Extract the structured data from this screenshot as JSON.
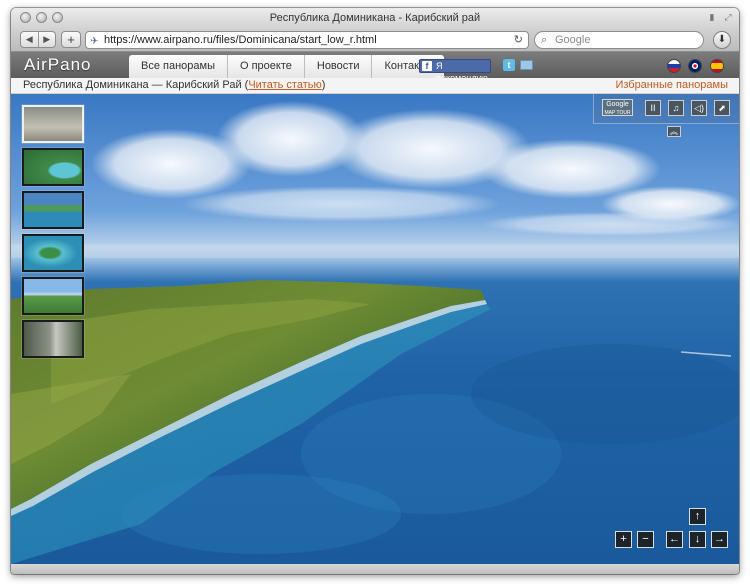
{
  "window": {
    "title": "Республика Доминикана - Карибский рай"
  },
  "toolbar": {
    "back_icon": "back-arrow-icon",
    "forward_icon": "forward-arrow-icon",
    "add_tab_label": "+",
    "url": "https://www.airpano.ru/files/Dominicana/start_low_r.html",
    "search_placeholder": "Google"
  },
  "site": {
    "logo": "AirPano",
    "nav": [
      {
        "label": "Все панорамы"
      },
      {
        "label": "О проекте"
      },
      {
        "label": "Новости"
      },
      {
        "label": "Контакты"
      }
    ],
    "facebook_label": "Я рекомендую",
    "languages": [
      "ru",
      "en",
      "es"
    ]
  },
  "subbar": {
    "title_prefix": "Республика Доминикана — Карибский Рай (",
    "read_link": "Читать статью",
    "title_suffix": ")",
    "favorites": "Избранные панорамы"
  },
  "pano_controls": {
    "google_map_label_1": "Google",
    "google_map_label_2": "MAP TOUR",
    "pause": "II",
    "zoom_in": "+",
    "zoom_out": "−",
    "up": "↑",
    "down": "↓",
    "left": "←",
    "right": "→"
  },
  "thumbnails": [
    {
      "name": "thumb-1",
      "active": true
    },
    {
      "name": "thumb-2",
      "active": false
    },
    {
      "name": "thumb-3",
      "active": false
    },
    {
      "name": "thumb-4",
      "active": false
    },
    {
      "name": "thumb-5",
      "active": false
    },
    {
      "name": "thumb-6",
      "active": false
    }
  ],
  "colors": {
    "link": "#c45a1c",
    "header_bg": "#6a6a6a",
    "sea": "#1f63a6"
  }
}
